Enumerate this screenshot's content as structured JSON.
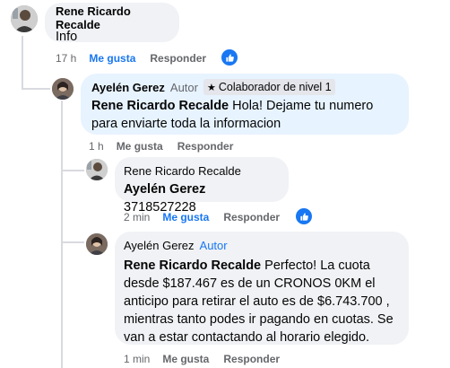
{
  "comments": [
    {
      "author": "Rene Ricardo Recalde",
      "text": "Info",
      "time": "17 h",
      "like_label": "Me gusta",
      "reply_label": "Responder",
      "has_reaction": true
    },
    {
      "author": "Ayelén Gerez",
      "author_tag": "Autor",
      "badge": "Colaborador de nivel 1",
      "mention": "Rene Ricardo Recalde",
      "text": "Hola! Dejame tu numero para enviarte toda la informacion",
      "time": "1 h",
      "like_label": "Me gusta",
      "reply_label": "Responder",
      "has_reaction": false
    },
    {
      "author": "Rene Ricardo Recalde",
      "mention": "Ayelén Gerez",
      "text": "3718527228",
      "time": "2 min",
      "like_label": "Me gusta",
      "reply_label": "Responder",
      "has_reaction": true
    },
    {
      "author": "Ayelén Gerez",
      "author_tag": "Autor",
      "mention": "Rene Ricardo Recalde",
      "text": "Perfecto! La cuota desde $187.467 es de un CRONOS 0KM el anticipo para retirar el auto es de $6.743.700 , mientras tanto podes ir pagando en cuotas. Se van a estar contactando al horario elegido.",
      "time": "1 min",
      "like_label": "Me gusta",
      "reply_label": "Responder",
      "has_reaction": false
    }
  ],
  "colors": {
    "bubble_grey": "#f0f2f5",
    "bubble_blue": "#e7f3ff",
    "reaction_blue": "#1877f2",
    "meta_grey": "#65676b"
  },
  "icons": {
    "like": "thumbs-up-icon",
    "badge": "star-icon"
  }
}
